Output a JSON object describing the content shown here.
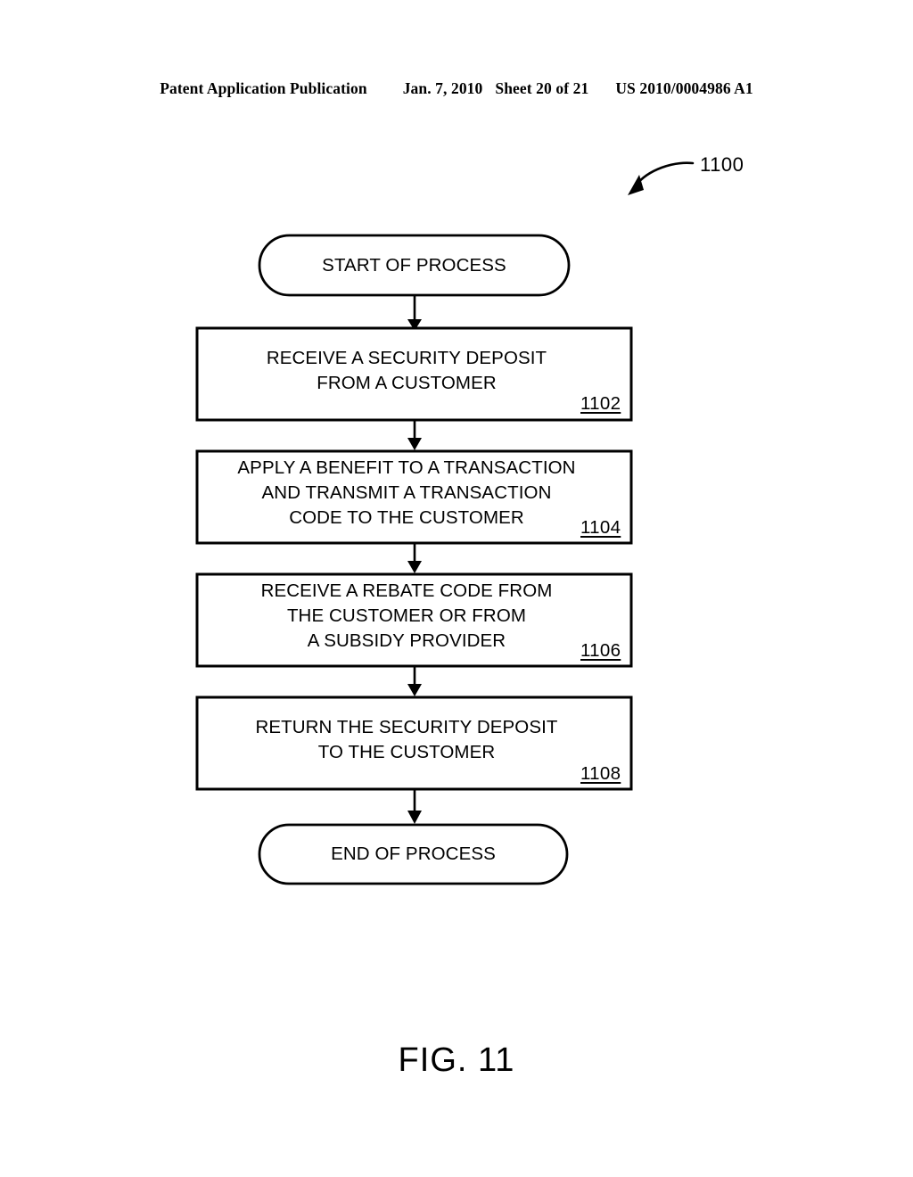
{
  "header": {
    "publication_label": "Patent Application Publication",
    "date": "Jan. 7, 2010",
    "sheet": "Sheet 20 of 21",
    "patent_number": "US 2010/0004986 A1"
  },
  "figure": {
    "caption": "FIG. 11",
    "callout_reference": "1100"
  },
  "flowchart": {
    "start_node": {
      "label": "START OF PROCESS"
    },
    "end_node": {
      "label": "END OF PROCESS"
    },
    "steps": [
      {
        "ref": "1102",
        "lines": [
          "RECEIVE A SECURITY DEPOSIT",
          "FROM A CUSTOMER"
        ]
      },
      {
        "ref": "1104",
        "lines": [
          "APPLY A BENEFIT TO A TRANSACTION",
          "AND TRANSMIT A TRANSACTION",
          "CODE TO THE CUSTOMER"
        ]
      },
      {
        "ref": "1106",
        "lines": [
          "RECEIVE A REBATE CODE FROM",
          "THE CUSTOMER OR FROM",
          "A SUBSIDY PROVIDER"
        ]
      },
      {
        "ref": "1108",
        "lines": [
          "RETURN THE SECURITY DEPOSIT",
          "TO THE CUSTOMER"
        ]
      }
    ]
  },
  "colors": {
    "ink": "#000000",
    "paper": "#ffffff"
  }
}
